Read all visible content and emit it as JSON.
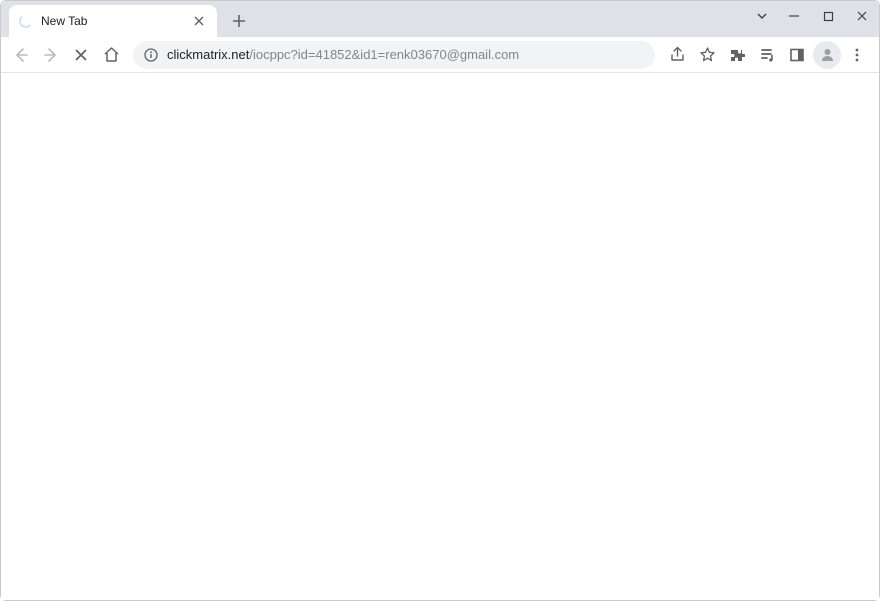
{
  "tab": {
    "title": "New Tab",
    "loading": true
  },
  "address": {
    "host": "clickmatrix.net",
    "path": "/iocppc?id=41852&id1=renk03670@gmail.com"
  },
  "nav": {
    "back_enabled": false,
    "forward_enabled": false
  }
}
